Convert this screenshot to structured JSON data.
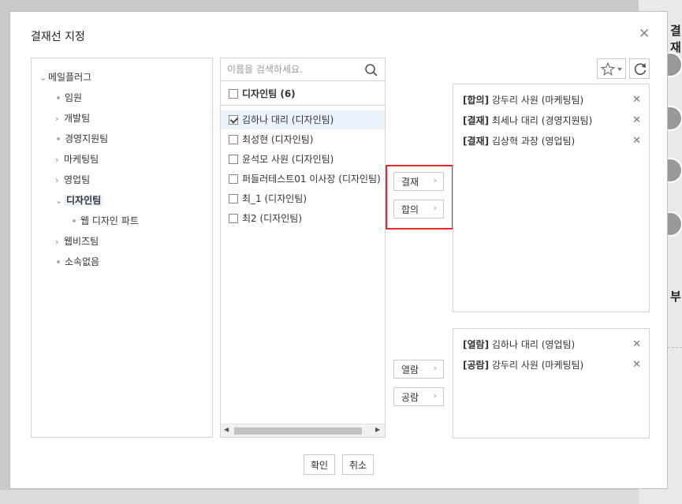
{
  "background": {
    "panel_title_1": "결재",
    "panel_title_2": "부"
  },
  "dialog": {
    "title": "결재선 지정",
    "close_icon": "close-icon"
  },
  "tree": {
    "items": [
      {
        "label": "메일플러그",
        "marker": "chevron-down"
      },
      {
        "label": "임원",
        "marker": "dot"
      },
      {
        "label": "개발팀",
        "marker": "chevron-right"
      },
      {
        "label": "경영지원팀",
        "marker": "dot"
      },
      {
        "label": "마케팅팀",
        "marker": "chevron-right"
      },
      {
        "label": "영업팀",
        "marker": "chevron-right"
      },
      {
        "label": "디자인팀",
        "marker": "chevron-down",
        "selected": true
      },
      {
        "label": "웹 디자인 파트",
        "marker": "dot"
      },
      {
        "label": "웹비즈팀",
        "marker": "chevron-right"
      },
      {
        "label": "소속없음",
        "marker": "dot"
      }
    ]
  },
  "members": {
    "search_placeholder": "이름을 검색하세요.",
    "group_label": "디자인팀 (6)",
    "rows": [
      {
        "label": "김하나 대리 (디자인팀)",
        "checked": true
      },
      {
        "label": "최성현 (디자인팀)",
        "checked": false
      },
      {
        "label": "윤석모 사원 (디자인팀)",
        "checked": false
      },
      {
        "label": "퍼들러테스트01 이사장 (디자인팀)",
        "checked": false
      },
      {
        "label": "최_1 (디자인팀)",
        "checked": false
      },
      {
        "label": "최2 (디자인팀)",
        "checked": false
      }
    ]
  },
  "buttons": {
    "approve": "결재",
    "agree": "합의",
    "view": "열람",
    "public_view": "공람",
    "chevron": "›",
    "confirm": "확인",
    "cancel": "취소"
  },
  "approval_line": [
    {
      "tag": "[합의]",
      "name": "강두리 사원 (마케팅팀)"
    },
    {
      "tag": "[결재]",
      "name": "최세나 대리 (경영지원팀)"
    },
    {
      "tag": "[결재]",
      "name": "김상혁 과장 (영업팀)"
    }
  ],
  "viewers_line": [
    {
      "tag": "[열람]",
      "name": "김하나 대리 (영업팀)"
    },
    {
      "tag": "[공람]",
      "name": "강두리 사원 (마케팅팀)"
    }
  ],
  "colors": {
    "highlight": "#e8282b",
    "selected_bg": "#eaf3fd"
  }
}
